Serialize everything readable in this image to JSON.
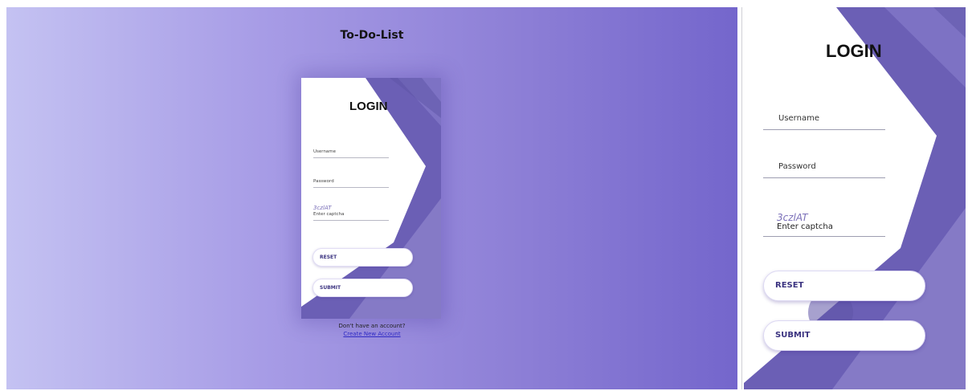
{
  "app": {
    "title": "To-Do-List"
  },
  "login": {
    "heading": "LOGIN",
    "username_label": "Username",
    "password_label": "Password",
    "captcha_code": "3czlAT",
    "captcha_label": "Enter captcha",
    "reset_label": "RESET",
    "submit_label": "SUBMIT"
  },
  "account": {
    "prompt": "Don't have an account?",
    "create_link": "Create New Account"
  },
  "colors": {
    "gradient_start": "#c4c2f2",
    "gradient_end": "#7466cc",
    "card_purple": "#6b5fb5",
    "button_text": "#3b3380"
  }
}
